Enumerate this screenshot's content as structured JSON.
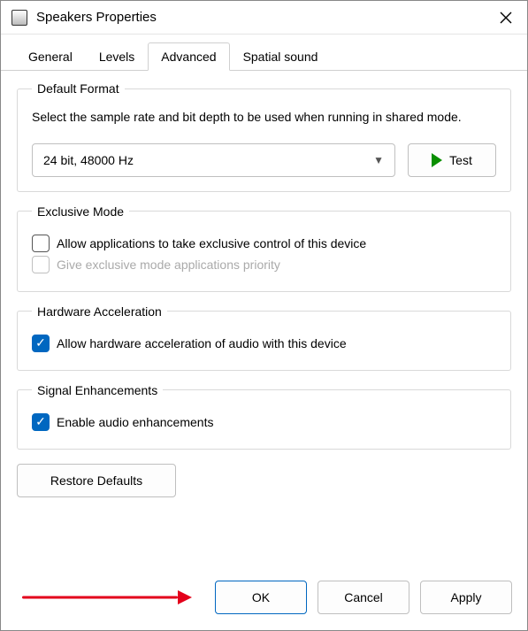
{
  "window": {
    "title": "Speakers Properties"
  },
  "tabs": {
    "general": "General",
    "levels": "Levels",
    "advanced": "Advanced",
    "spatial": "Spatial sound",
    "active": "advanced"
  },
  "default_format": {
    "legend": "Default Format",
    "description": "Select the sample rate and bit depth to be used when running in shared mode.",
    "selected": "24 bit, 48000 Hz",
    "test_label": "Test"
  },
  "exclusive_mode": {
    "legend": "Exclusive Mode",
    "allow_exclusive": {
      "label": "Allow applications to take exclusive control of this device",
      "checked": false
    },
    "priority": {
      "label": "Give exclusive mode applications priority",
      "checked": false,
      "enabled": false
    }
  },
  "hw_accel": {
    "legend": "Hardware Acceleration",
    "allow": {
      "label": "Allow hardware acceleration of audio with this device",
      "checked": true
    }
  },
  "signal_enh": {
    "legend": "Signal Enhancements",
    "enable": {
      "label": "Enable audio enhancements",
      "checked": true
    }
  },
  "buttons": {
    "restore": "Restore Defaults",
    "ok": "OK",
    "cancel": "Cancel",
    "apply": "Apply"
  }
}
